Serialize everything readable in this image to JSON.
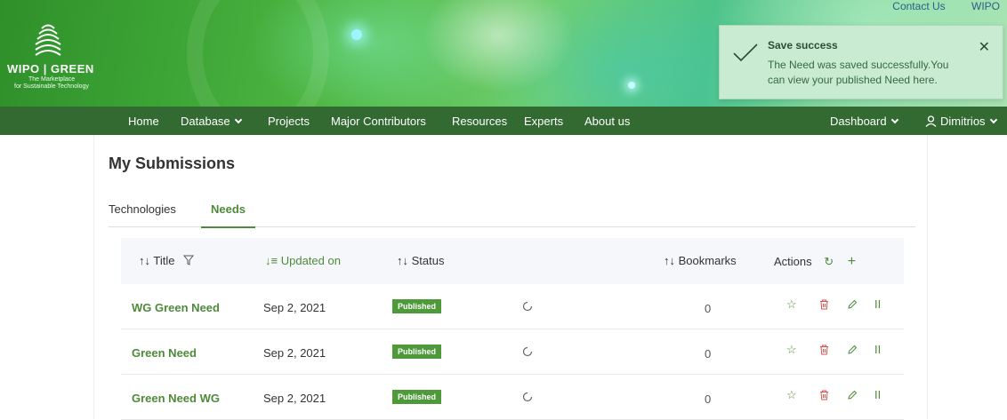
{
  "header": {
    "logo_name": "WIPO | GREEN",
    "logo_sub1": "The Marketplace",
    "logo_sub2": "for Sustainable Technology",
    "top_links": [
      "Contact Us",
      "WIPO"
    ]
  },
  "toast": {
    "title": "Save success",
    "message": "The Need was saved successfully.You can view your published Need here.",
    "icon": "check-icon",
    "close": "✕"
  },
  "nav": {
    "items": [
      "Home",
      "Database",
      "Projects",
      "Major Contributors",
      "Resources",
      "Experts",
      "About us"
    ],
    "dashboard": "Dashboard",
    "user": "Dimitrios"
  },
  "page": {
    "title": "My Submissions",
    "tabs": [
      "Technologies",
      "Needs"
    ],
    "active_tab": "Needs"
  },
  "table": {
    "columns": {
      "title": "Title",
      "updated": "Updated on",
      "status": "Status",
      "bookmarks": "Bookmarks",
      "actions": "Actions"
    },
    "rows": [
      {
        "title": "WG Green Need",
        "updated": "Sep 2, 2021",
        "status": "Published",
        "bookmarks": "0"
      },
      {
        "title": "Green Need",
        "updated": "Sep 2, 2021",
        "status": "Published",
        "bookmarks": "0"
      },
      {
        "title": "Green Need WG",
        "updated": "Sep 2, 2021",
        "status": "Published",
        "bookmarks": "0"
      }
    ]
  },
  "colors": {
    "accent": "#4e8a3a",
    "nav_bg": "#336a32",
    "delete": "#d9534f",
    "toast_bg": "#c9ebd2"
  }
}
